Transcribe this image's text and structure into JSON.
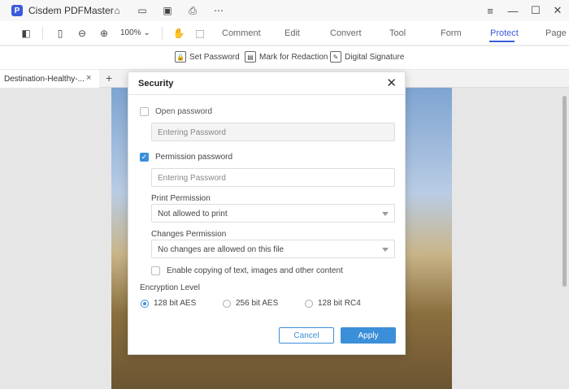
{
  "app": {
    "title": "Cisdem PDFMaster",
    "logo_letter": "P"
  },
  "titlebar_icons": [
    "home-icon",
    "folder-icon",
    "save-icon",
    "print-icon",
    "more-icon"
  ],
  "window_controls": [
    "menu-icon",
    "minimize-icon",
    "maximize-icon",
    "close-icon"
  ],
  "toolbar": {
    "zoom": "100%",
    "tabs": [
      "Comment",
      "Edit",
      "Convert",
      "Tool",
      "Form",
      "Protect",
      "Page"
    ],
    "active_tab": "Protect"
  },
  "subtoolbar": {
    "set_password": "Set Password",
    "mark_redaction": "Mark for Redaction",
    "digital_signature": "Digital Signature"
  },
  "doc_tab": {
    "name": "Destination-Healthy-...",
    "close": "×",
    "add": "+"
  },
  "dialog": {
    "title": "Security",
    "close": "✕",
    "open_password": {
      "label": "Open password",
      "checked": false,
      "placeholder": "Entering Password"
    },
    "permission_password": {
      "label": "Permission password",
      "checked": true,
      "placeholder": "Entering Password"
    },
    "print_permission": {
      "label": "Print Permission",
      "value": "Not allowed to print"
    },
    "changes_permission": {
      "label": "Changes Permission",
      "value": "No changes are allowed on this file"
    },
    "enable_copying": {
      "label": "Enable copying of text, images and other content",
      "checked": false
    },
    "encryption": {
      "label": "Encryption Level",
      "options": [
        "128 bit AES",
        "256 bit AES",
        "128 bit RC4"
      ],
      "selected": "128 bit AES"
    },
    "cancel": "Cancel",
    "apply": "Apply"
  },
  "colors": {
    "accent": "#3b5bdb",
    "dialog_accent": "#3b8fd9"
  }
}
